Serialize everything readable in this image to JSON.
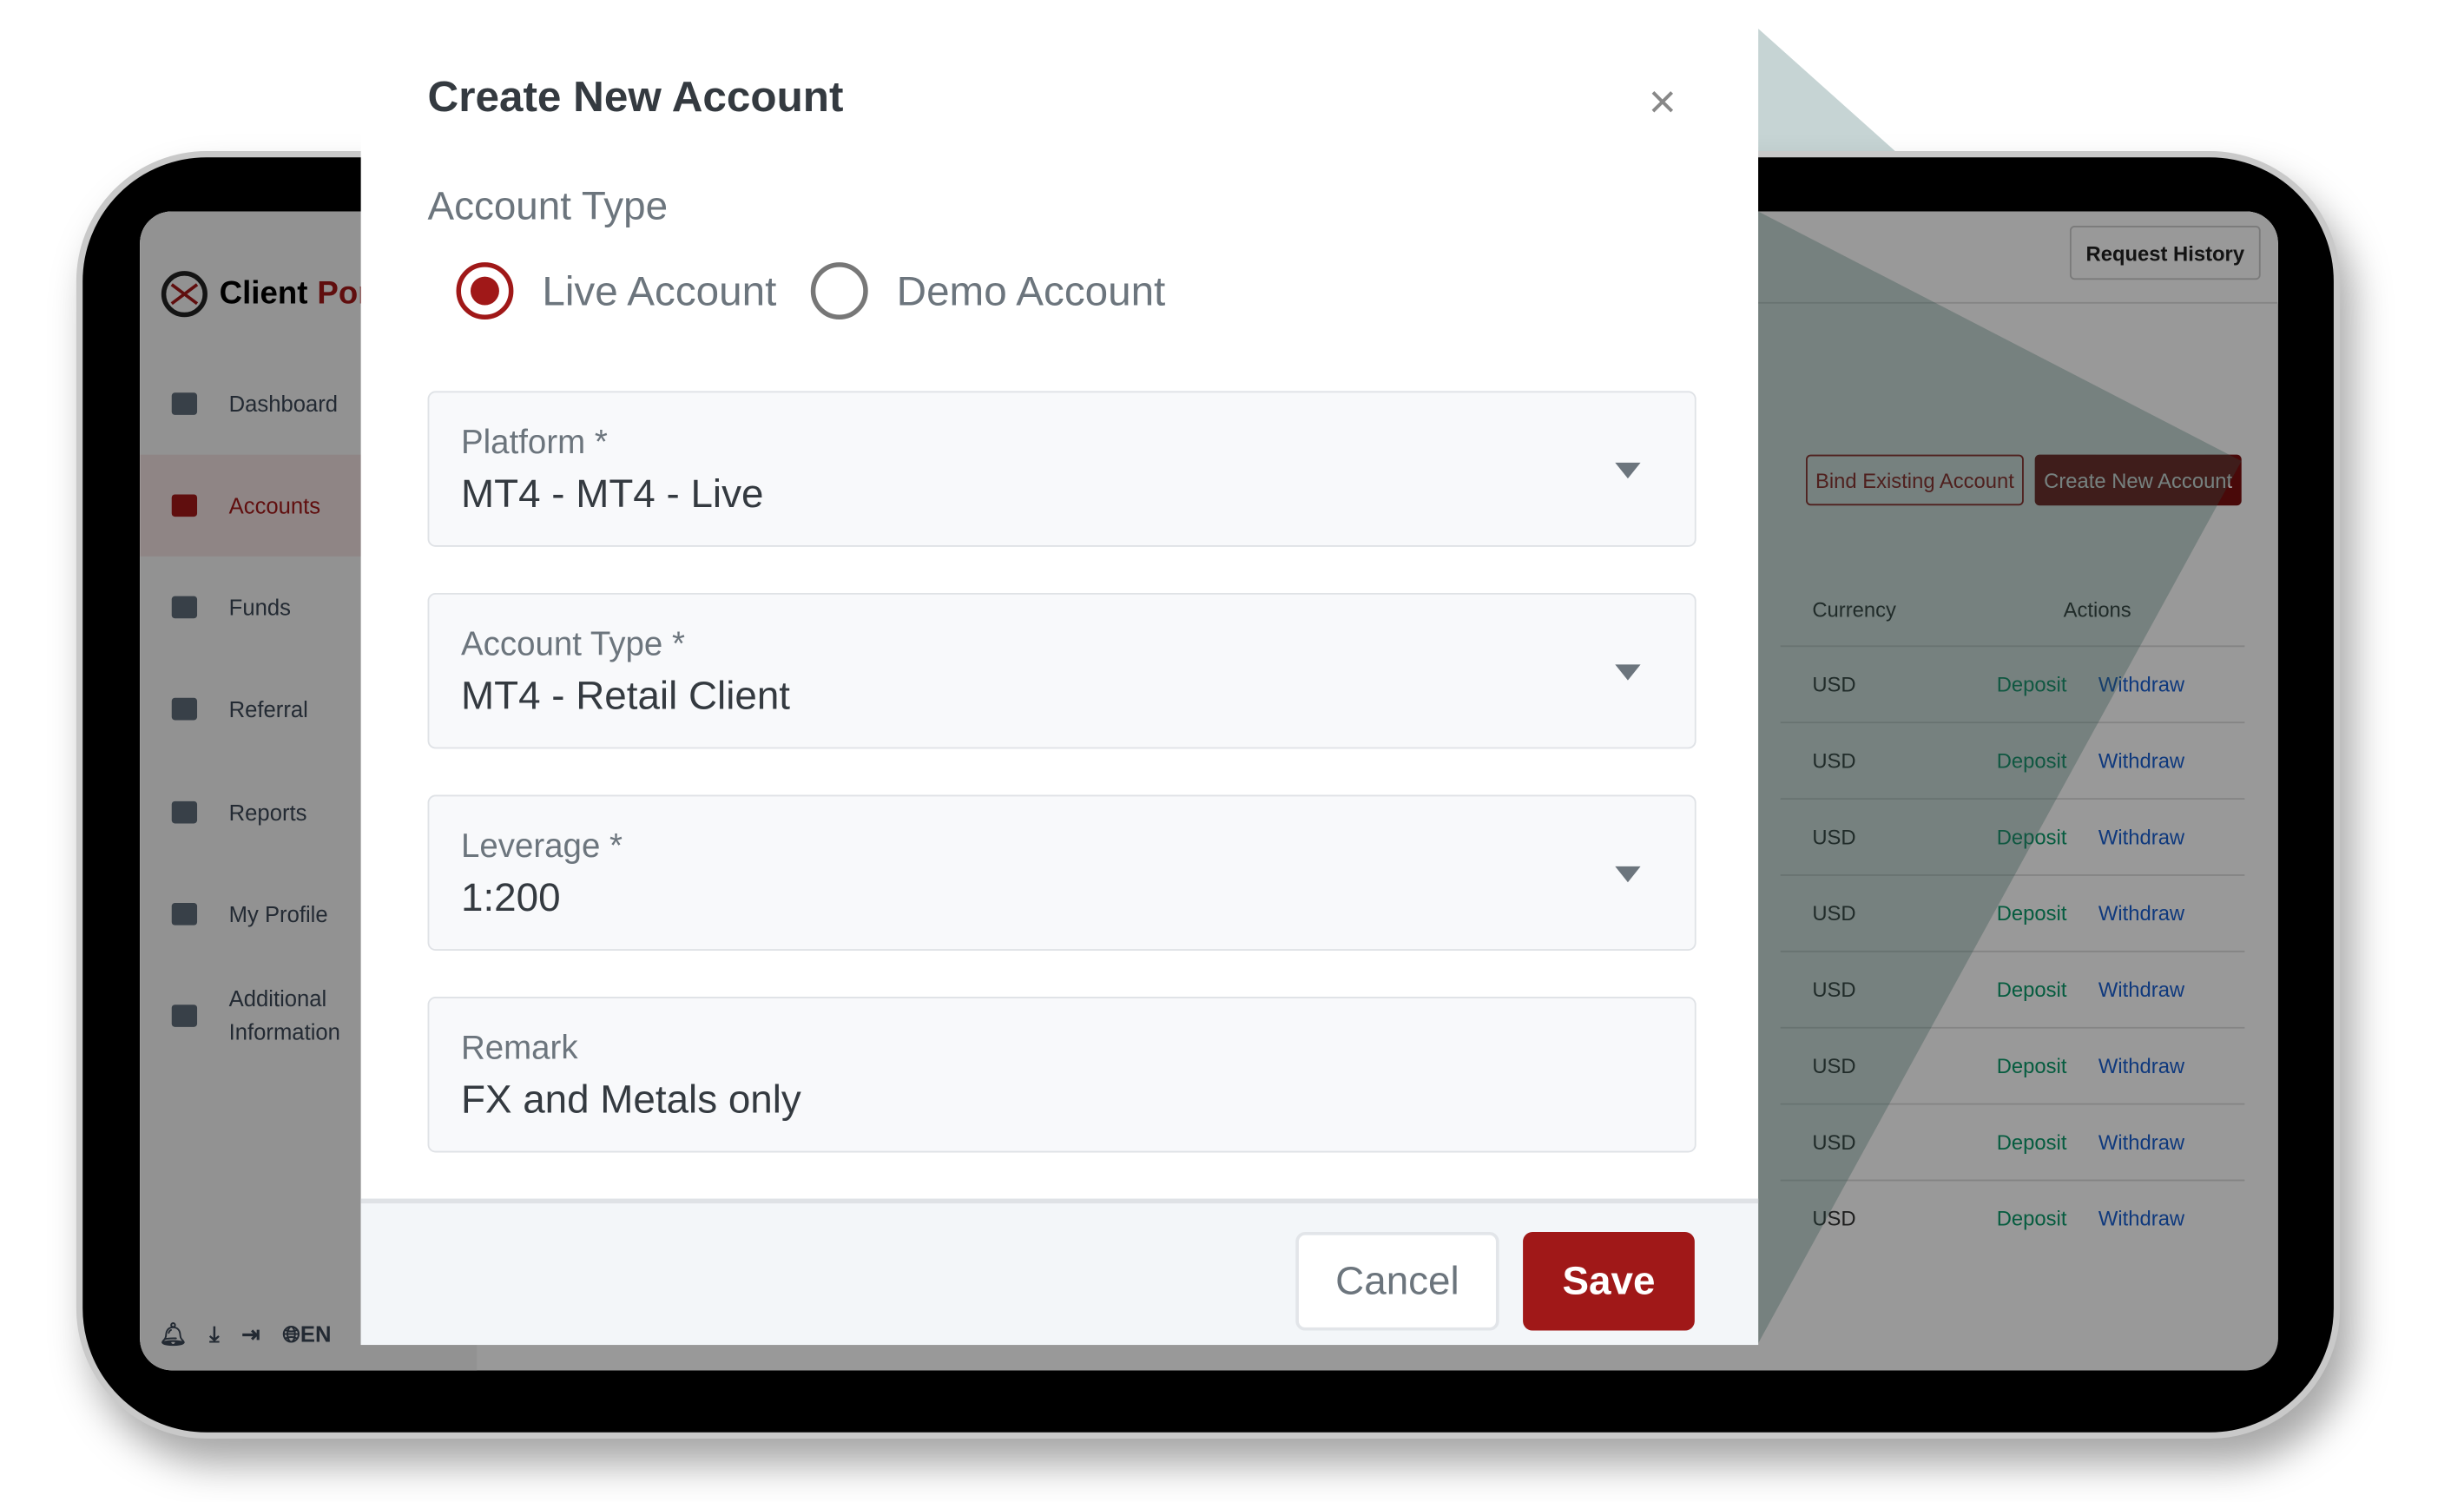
{
  "colors": {
    "brand_red": "#a01818",
    "deposit": "#0a9a6a",
    "withdraw": "#1a5fd1"
  },
  "sidebar": {
    "logo": {
      "prefix": "Client",
      "suffix": "Por"
    },
    "items": [
      {
        "label": "Dashboard",
        "icon": "dashboard-icon"
      },
      {
        "label": "Accounts",
        "icon": "candlestick-icon",
        "active": true
      },
      {
        "label": "Funds",
        "icon": "wallet-icon"
      },
      {
        "label": "Referral",
        "icon": "users-icon"
      },
      {
        "label": "Reports",
        "icon": "pie-chart-icon"
      },
      {
        "label": "My Profile",
        "icon": "user-icon"
      },
      {
        "label": "Additional Information",
        "icon": "card-icon"
      }
    ],
    "bottom": {
      "language": "EN"
    }
  },
  "header": {
    "request_history": "Request History"
  },
  "accounts": {
    "bind_label": "Bind Existing Account",
    "create_label": "Create New Account",
    "columns": [
      "Currency",
      "Actions"
    ],
    "rows": [
      {
        "currency": "USD",
        "deposit": "Deposit",
        "withdraw": "Withdraw"
      },
      {
        "currency": "USD",
        "deposit": "Deposit",
        "withdraw": "Withdraw"
      },
      {
        "currency": "USD",
        "deposit": "Deposit",
        "withdraw": "Withdraw"
      },
      {
        "currency": "USD",
        "deposit": "Deposit",
        "withdraw": "Withdraw"
      },
      {
        "currency": "USD",
        "deposit": "Deposit",
        "withdraw": "Withdraw"
      },
      {
        "currency": "USD",
        "deposit": "Deposit",
        "withdraw": "Withdraw"
      },
      {
        "currency": "USD",
        "deposit": "Deposit",
        "withdraw": "Withdraw"
      },
      {
        "currency": "USD",
        "deposit": "Deposit",
        "withdraw": "Withdraw"
      }
    ]
  },
  "modal": {
    "title": "Create New Account",
    "close": "×",
    "account_type_label": "Account Type",
    "radios": [
      {
        "label": "Live Account",
        "checked": true
      },
      {
        "label": "Demo Account",
        "checked": false
      }
    ],
    "fields": [
      {
        "label": "Platform *",
        "value": "MT4 - MT4 - Live",
        "dropdown": true
      },
      {
        "label": "Account Type *",
        "value": "MT4 - Retail Client",
        "dropdown": true
      },
      {
        "label": "Leverage *",
        "value": "1:200",
        "dropdown": true
      },
      {
        "label": "Remark",
        "value": "FX and Metals only",
        "dropdown": false
      }
    ],
    "cancel": "Cancel",
    "save": "Save"
  }
}
